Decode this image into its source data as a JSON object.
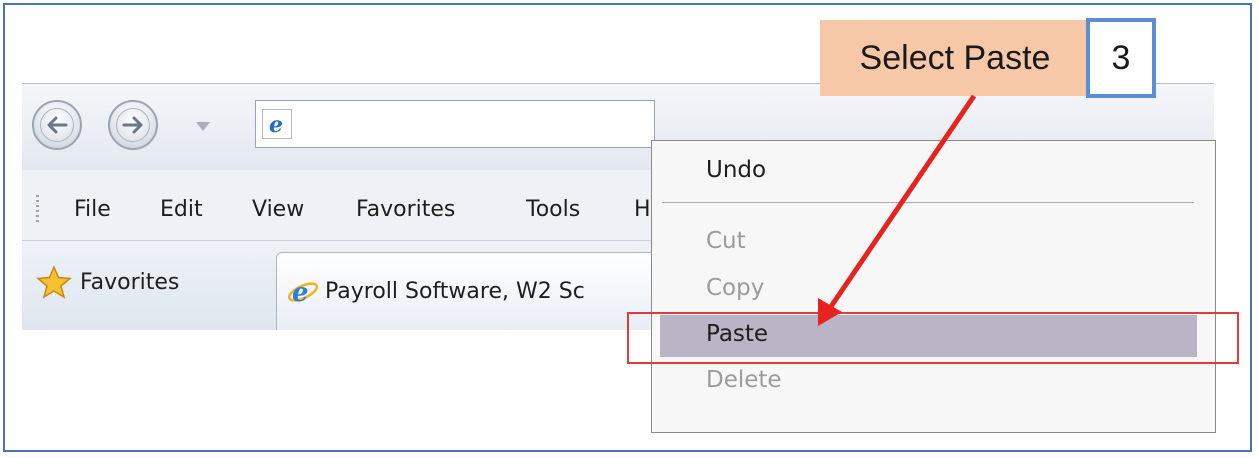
{
  "callout": {
    "text": "Select Paste",
    "step": "3"
  },
  "menubar": {
    "items": [
      "File",
      "Edit",
      "View",
      "Favorites",
      "Tools",
      "H"
    ]
  },
  "favorites_bar": {
    "favorites_label": "Favorites",
    "tab_label": "Payroll Software, W2 Sc"
  },
  "context_menu": {
    "undo": "Undo",
    "cut": "Cut",
    "copy": "Copy",
    "paste": "Paste",
    "delete": "Delete"
  },
  "colors": {
    "frame_border": "#4a72b8",
    "callout_bg": "#f7c8a7",
    "step_box_border": "#5b8fd3",
    "highlight": "#b9b5c6",
    "annotation_red": "#e53a3a"
  },
  "icons": [
    "back-icon",
    "forward-icon",
    "dropdown-icon",
    "ie-icon",
    "favorites-star-icon"
  ]
}
